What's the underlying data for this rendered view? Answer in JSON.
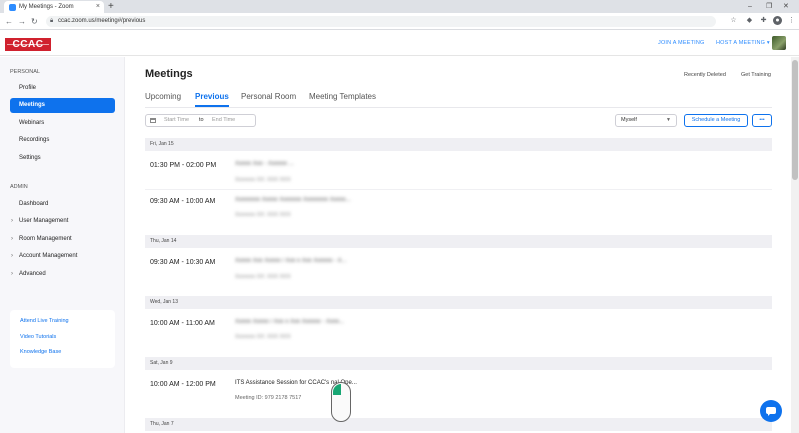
{
  "browser": {
    "tab_title": "My Meetings - Zoom",
    "tab_close": "×",
    "new_tab": "+",
    "url": "ccac.zoom.us/meeting#/previous",
    "minimize": "–",
    "maximize": "❐",
    "close": "✕"
  },
  "topnav": {
    "logo_text": "CCAC",
    "join_meeting": "JOIN A MEETING",
    "host_meeting": "HOST A MEETING ▾"
  },
  "sidebar": {
    "personal_label": "PERSONAL",
    "personal_items": [
      "Profile",
      "Meetings",
      "Webinars",
      "Recordings",
      "Settings"
    ],
    "admin_label": "ADMIN",
    "admin_items": [
      "Dashboard",
      "User Management",
      "Room Management",
      "Account Management",
      "Advanced"
    ],
    "help_links": [
      "Attend Live Training",
      "Video Tutorials",
      "Knowledge Base"
    ]
  },
  "main": {
    "title": "Meetings",
    "recently_deleted": "Recently Deleted",
    "get_training": "Get Training",
    "tabs": [
      "Upcoming",
      "Previous",
      "Personal Room",
      "Meeting Templates"
    ],
    "start_placeholder": "Start Time",
    "to_label": "to",
    "end_placeholder": "End Time",
    "filter_value": "Myself",
    "schedule_button": "Schedule a Meeting",
    "more_button": "•••"
  },
  "meetings": {
    "groups": [
      {
        "date": "Fri, Jan 15"
      },
      {
        "date": "Thu, Jan 14"
      },
      {
        "date": "Wed, Jan 13"
      },
      {
        "date": "Sat, Jan 9"
      },
      {
        "date": "Thu, Jan 7"
      }
    ],
    "rows": [
      {
        "time": "01:30 PM - 02:00 PM",
        "title": "Xxxxx Xxx - Xxxxxx ...",
        "sub": "Xxxxxxx XX: XXX XXX"
      },
      {
        "time": "09:30 AM - 10:00 AM",
        "title": "Xxxxxxxx Xxxxx Xxxxxxx Xxxxxxxx Xxxxx...",
        "sub": "Xxxxxxx XX: XXX XXX"
      },
      {
        "time": "09:30 AM - 10:30 AM",
        "title": "Xxxxx Xxx Xxxxx / Xxx x Xxx Xxxxxx - X...",
        "sub": "Xxxxxxx XX: XXX XXX"
      },
      {
        "time": "10:00 AM - 11:00 AM",
        "title": "Xxxxx Xxxxx / Xxx x Xxx Xxxxxx - Xxxx...",
        "sub": "Xxxxxxx XX: XXX XXX"
      },
      {
        "time": "10:00 AM - 12:00 PM",
        "title": "ITS Assistance Session for CCAC's   nal Ope...",
        "sub": "Meeting ID: 979 2178 7517"
      }
    ]
  },
  "colors": {
    "accent": "#0e72ed",
    "brand_red": "#d0212e"
  }
}
